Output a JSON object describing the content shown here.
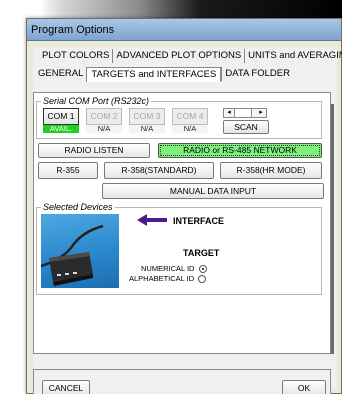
{
  "window": {
    "title": "Program Options"
  },
  "tabs": {
    "row1": [
      "PLOT COLORS",
      "ADVANCED PLOT OPTIONS",
      "UNITS and AVERAGING"
    ],
    "row2": [
      "GENERAL",
      "TARGETS and INTERFACES",
      "DATA FOLDER"
    ],
    "active": "TARGETS and INTERFACES"
  },
  "serial": {
    "legend": "Serial COM Port (RS232c)",
    "ports": [
      {
        "label": "COM 1",
        "status": "AVAIL.",
        "state": "available"
      },
      {
        "label": "COM 2",
        "status": "N/A",
        "state": "disabled"
      },
      {
        "label": "COM 3",
        "status": "N/A",
        "state": "disabled"
      },
      {
        "label": "COM 4",
        "status": "N/A",
        "state": "disabled"
      }
    ],
    "scan_label": "SCAN"
  },
  "buttons": {
    "radio_listen": "RADIO LISTEN",
    "radio_network": "RADIO or RS-485 NETWORK",
    "r355": "R-355",
    "r358_standard": "R-358(STANDARD)",
    "r358_hr": "R-358(HR MODE)",
    "manual_input": "MANUAL DATA INPUT"
  },
  "selected": {
    "legend": "Selected Devices",
    "interface_label": "INTERFACE",
    "target_label": "TARGET",
    "numerical_id": "NUMERICAL ID",
    "alphabetical_id": "ALPHABETICAL ID",
    "id_mode": "numerical"
  },
  "footer": {
    "cancel": "CANCEL",
    "ok": "OK"
  },
  "colors": {
    "avail_green": "#1fd11f",
    "network_green": "#7ef07e",
    "arrow_purple": "#4b1a8c",
    "device_blue": "#2b87cc"
  },
  "icons": {
    "arrow": "left-arrow-icon",
    "device": "interface-device-image"
  }
}
